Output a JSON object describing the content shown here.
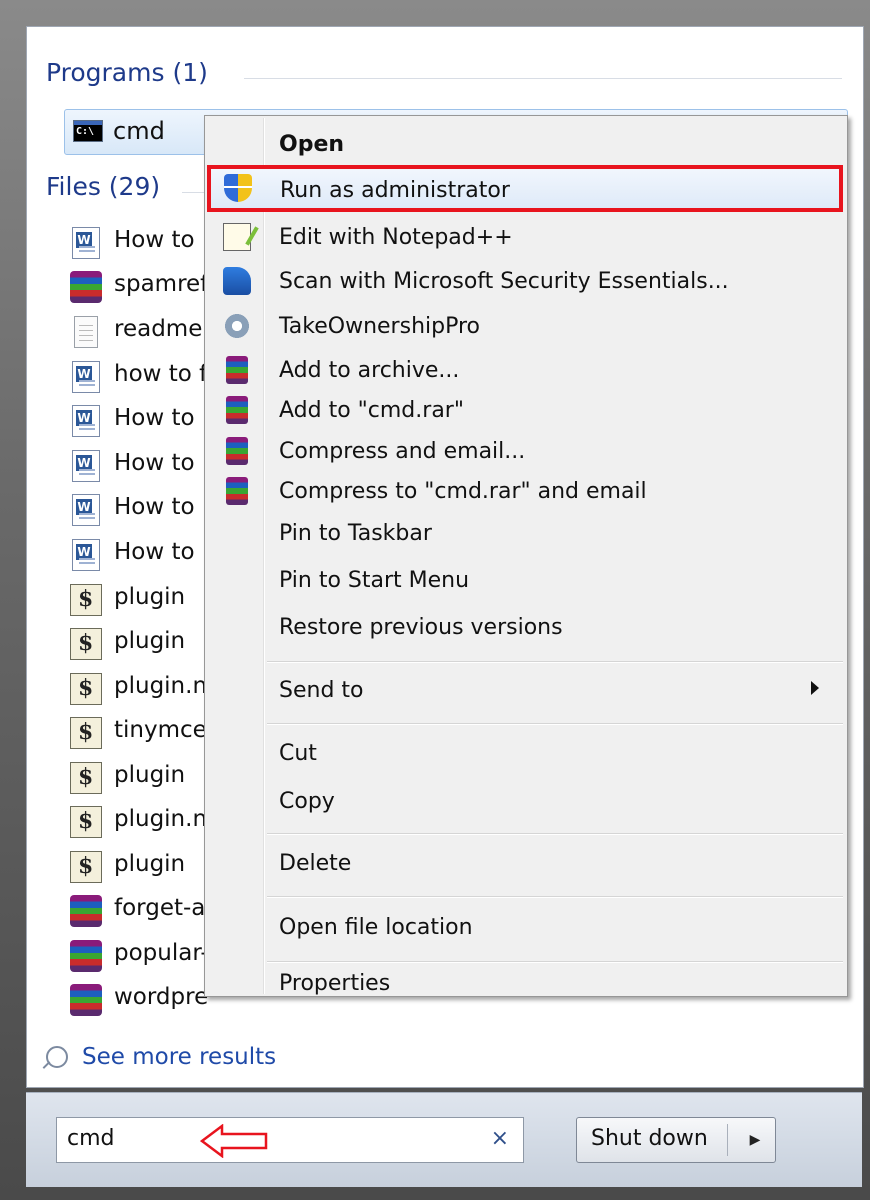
{
  "programs": {
    "header": "Programs (1)",
    "items": [
      {
        "label": "cmd",
        "icon": "cmd-icon"
      }
    ]
  },
  "files": {
    "header": "Files (29)",
    "items": [
      {
        "label": "How to",
        "icon": "word-document-icon"
      },
      {
        "label": "spamref",
        "icon": "winrar-archive-icon"
      },
      {
        "label": "readme",
        "icon": "text-file-icon"
      },
      {
        "label": "how to f",
        "icon": "word-document-icon"
      },
      {
        "label": "How to",
        "icon": "word-document-icon"
      },
      {
        "label": "How to",
        "icon": "word-document-icon"
      },
      {
        "label": "How to",
        "icon": "word-document-icon"
      },
      {
        "label": "How to",
        "icon": "word-document-icon"
      },
      {
        "label": "plugin",
        "icon": "php-script-icon"
      },
      {
        "label": "plugin",
        "icon": "php-script-icon"
      },
      {
        "label": "plugin.n",
        "icon": "php-script-icon"
      },
      {
        "label": "tinymce",
        "icon": "php-script-icon"
      },
      {
        "label": "plugin",
        "icon": "php-script-icon"
      },
      {
        "label": "plugin.n",
        "icon": "php-script-icon"
      },
      {
        "label": "plugin",
        "icon": "php-script-icon"
      },
      {
        "label": "forget-a",
        "icon": "winrar-archive-icon"
      },
      {
        "label": "popular-",
        "icon": "winrar-archive-icon"
      },
      {
        "label": "wordpre",
        "icon": "winrar-archive-icon"
      }
    ]
  },
  "see_more": "See more results",
  "search": {
    "value": "cmd",
    "clear": "×"
  },
  "shutdown": {
    "label": "Shut down",
    "arrow": "▶"
  },
  "context_menu": {
    "items": [
      {
        "label": "Open",
        "icon": ""
      },
      {
        "label": "Run as administrator",
        "icon": "uac-shield-icon"
      },
      {
        "label": "Edit with Notepad++",
        "icon": "notepad-plus-plus-icon"
      },
      {
        "label": "Scan with Microsoft Security Essentials...",
        "icon": "security-essentials-icon"
      },
      {
        "label": "TakeOwnershipPro",
        "icon": "gear-icon"
      },
      {
        "label": "Add to archive...",
        "icon": "winrar-icon"
      },
      {
        "label": "Add to \"cmd.rar\"",
        "icon": "winrar-icon"
      },
      {
        "label": "Compress and email...",
        "icon": "winrar-icon"
      },
      {
        "label": "Compress to \"cmd.rar\" and email",
        "icon": "winrar-icon"
      },
      {
        "label": "Pin to Taskbar",
        "icon": ""
      },
      {
        "label": "Pin to Start Menu",
        "icon": ""
      },
      {
        "label": "Restore previous versions",
        "icon": ""
      },
      {
        "label": "Send to",
        "icon": ""
      },
      {
        "label": "Cut",
        "icon": ""
      },
      {
        "label": "Copy",
        "icon": ""
      },
      {
        "label": "Delete",
        "icon": ""
      },
      {
        "label": "Open file location",
        "icon": ""
      },
      {
        "label": "Properties",
        "icon": ""
      }
    ]
  },
  "colors": {
    "highlight_border": "#e8141e",
    "link": "#1f4aa8",
    "section_header": "#1e3a8a"
  }
}
